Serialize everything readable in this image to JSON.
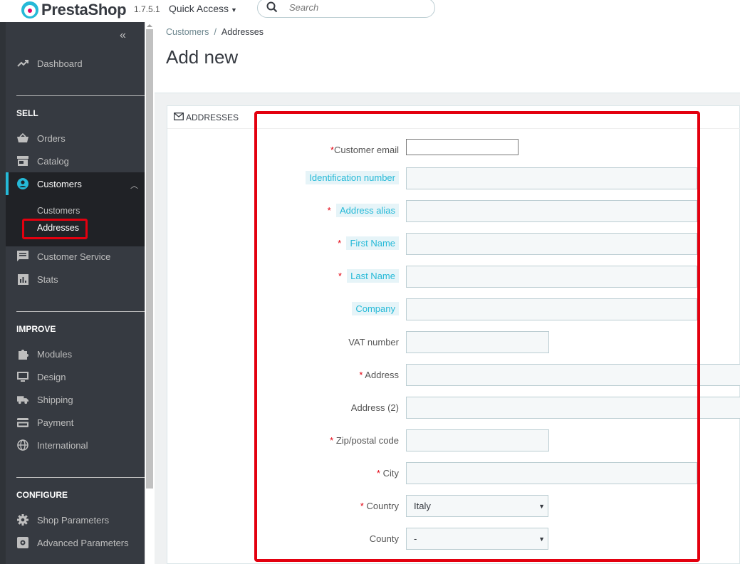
{
  "topbar": {
    "brand": "PrestaShop",
    "version": "1.7.5.1",
    "quick_access": "Quick Access",
    "search_placeholder": "Search"
  },
  "sidebar": {
    "dashboard": "Dashboard",
    "sections": {
      "sell": "SELL",
      "improve": "IMPROVE",
      "configure": "CONFIGURE"
    },
    "sell_items": [
      "Orders",
      "Catalog",
      "Customers"
    ],
    "customers_sub": [
      "Customers",
      "Addresses"
    ],
    "sell_items_after": [
      "Customer Service",
      "Stats"
    ],
    "improve_items": [
      "Modules",
      "Design",
      "Shipping",
      "Payment",
      "International"
    ],
    "configure_items": [
      "Shop Parameters",
      "Advanced Parameters"
    ]
  },
  "breadcrumb": {
    "parent": "Customers",
    "separator": "/",
    "current": "Addresses"
  },
  "page_title": "Add new",
  "panel": {
    "heading": "ADDRESSES"
  },
  "form": {
    "fields": [
      {
        "label": "Customer email",
        "required": true,
        "hint": false,
        "value": ""
      },
      {
        "label": "Identification number",
        "required": false,
        "hint": true,
        "value": ""
      },
      {
        "label": "Address alias",
        "required": true,
        "hint": true,
        "value": ""
      },
      {
        "label": "First Name",
        "required": true,
        "hint": true,
        "value": ""
      },
      {
        "label": "Last Name",
        "required": true,
        "hint": true,
        "value": ""
      },
      {
        "label": "Company",
        "required": false,
        "hint": true,
        "value": ""
      },
      {
        "label": "VAT number",
        "required": false,
        "hint": false,
        "value": ""
      },
      {
        "label": "Address",
        "required": true,
        "hint": false,
        "value": ""
      },
      {
        "label": "Address (2)",
        "required": false,
        "hint": false,
        "value": ""
      },
      {
        "label": "Zip/postal code",
        "required": true,
        "hint": false,
        "value": ""
      },
      {
        "label": "City",
        "required": true,
        "hint": false,
        "value": ""
      },
      {
        "label": "Country",
        "required": true,
        "hint": false,
        "value": "Italy"
      },
      {
        "label": "County",
        "required": false,
        "hint": false,
        "value": "-"
      }
    ],
    "required_mark": "*"
  },
  "colors": {
    "accent": "#25b9d7",
    "sidebar_bg": "#363a41",
    "highlight_red": "#e3000f"
  }
}
